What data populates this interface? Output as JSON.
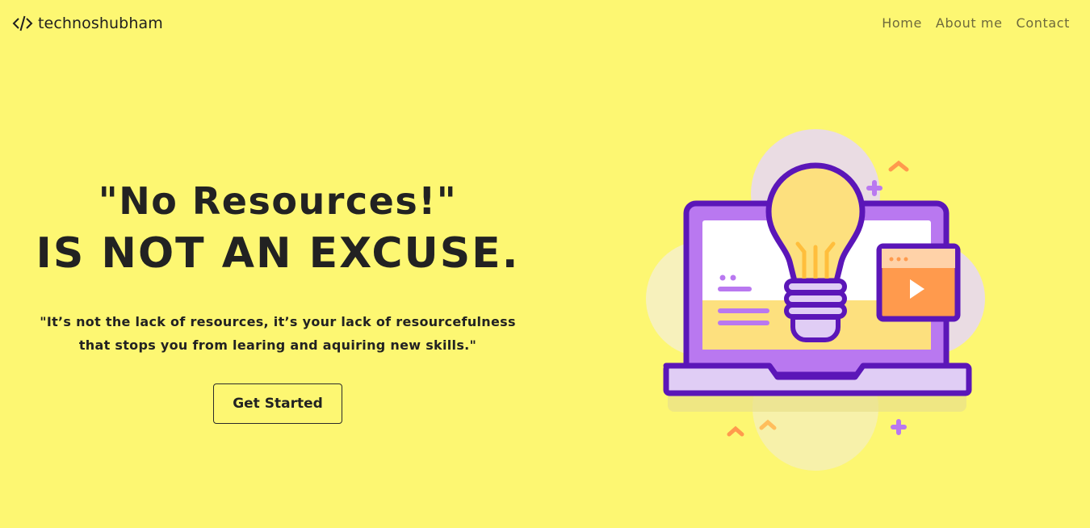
{
  "brand": {
    "name": "technoshubham",
    "icon": "code-brackets-icon"
  },
  "nav": {
    "items": [
      {
        "label": "Home"
      },
      {
        "label": "About me"
      },
      {
        "label": "Contact"
      }
    ]
  },
  "hero": {
    "headline_line1": "\"No Resources!\"",
    "headline_line2": "IS NOT AN EXCUSE.",
    "quote_line1": "\"It’s not the lack of resources, it’s your lack of resourcefulness",
    "quote_line2": "that stops you from learing and aquiring new skills.\"",
    "cta_label": "Get Started"
  },
  "colors": {
    "background": "#fdf772",
    "text": "#222222",
    "accent_purple": "#5b16b8",
    "accent_orange": "#ff9a4d"
  }
}
